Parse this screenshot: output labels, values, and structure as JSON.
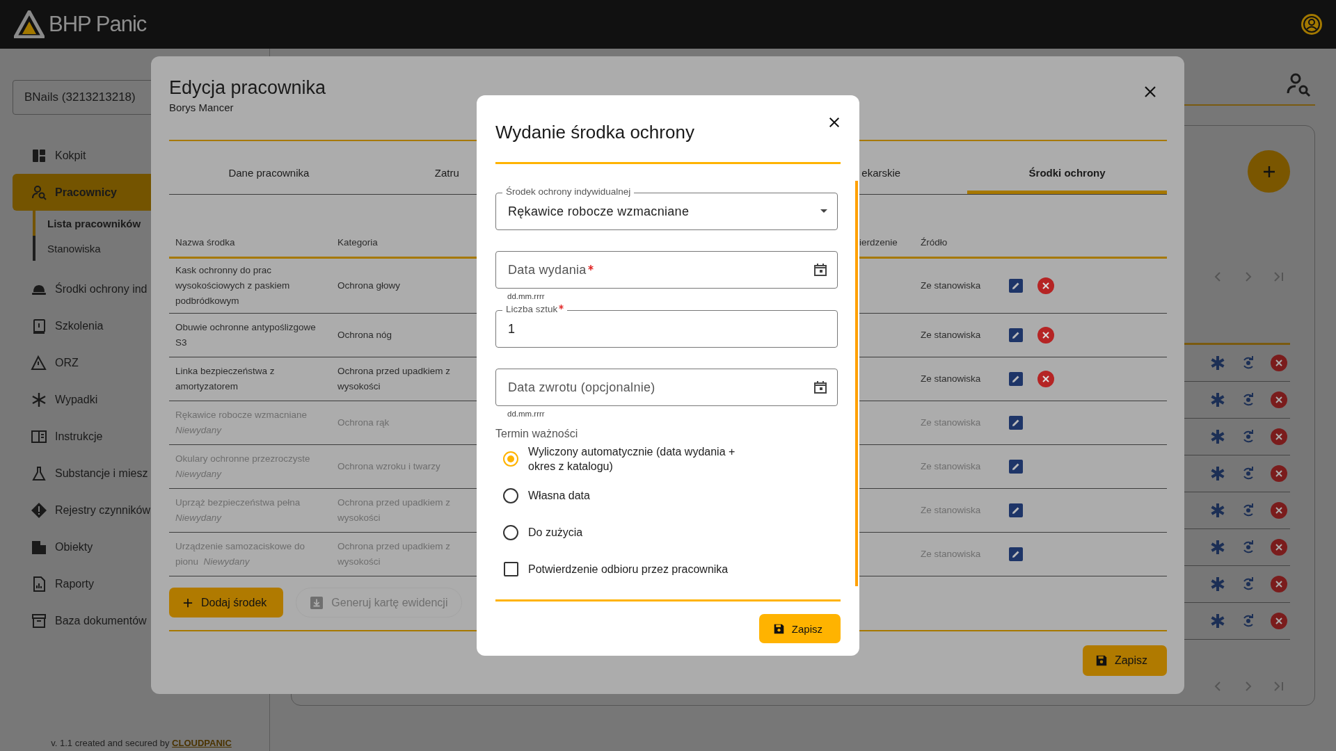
{
  "header": {
    "logo": "BHP Panic"
  },
  "sidebar": {
    "company": "BNails (3213213218)",
    "items": [
      {
        "label": "Kokpit",
        "selected": false
      },
      {
        "label": "Pracownicy",
        "selected": true,
        "children": [
          {
            "label": "Lista pracowników",
            "selected": true
          },
          {
            "label": "Stanowiska",
            "selected": false
          }
        ]
      },
      {
        "label": "Środki ochrony ind",
        "selected": false
      },
      {
        "label": "Szkolenia",
        "selected": false
      },
      {
        "label": "ORZ",
        "selected": false
      },
      {
        "label": "Wypadki",
        "selected": false
      },
      {
        "label": "Instrukcje",
        "selected": false
      },
      {
        "label": "Substancje i miesz",
        "selected": false
      },
      {
        "label": "Rejestry czynników",
        "selected": false
      },
      {
        "label": "Obiekty",
        "selected": false
      },
      {
        "label": "Raporty",
        "selected": false
      },
      {
        "label": "Baza dokumentów",
        "selected": false
      }
    ],
    "footer": {
      "text": "v. 1.1 created and secured by",
      "link": "CLOUDPANIC"
    }
  },
  "employee_dialog": {
    "title": "Edycja pracownika",
    "subtitle": "Borys Mancer",
    "tabs": [
      {
        "label": "Dane pracownika",
        "selected": false
      },
      {
        "label": "Zatru",
        "selected": false
      },
      {
        "label": "ekarskie",
        "selected": false
      },
      {
        "label": "Środki ochrony",
        "selected": true
      }
    ],
    "table": {
      "columns": [
        "Nazwa środka",
        "Kategoria",
        "ierdzenie",
        "Źródło"
      ],
      "rows": [
        {
          "name": "Kask ochronny do prac wysokościowych z paskiem podbródkowym",
          "category": "Ochrona głowy",
          "source": "Ze stanowiska",
          "issued": true
        },
        {
          "name": "Obuwie ochronne antypoślizgowe S3",
          "category": "Ochrona nóg",
          "source": "Ze stanowiska",
          "issued": true
        },
        {
          "name": "Linka bezpieczeństwa z amortyzatorem",
          "category": "Ochrona przed upadkiem z wysokości",
          "source": "Ze stanowiska",
          "issued": true
        },
        {
          "name": "Rękawice robocze wzmacniane",
          "status": "Niewydany",
          "category": "Ochrona rąk",
          "source": "Ze stanowiska",
          "issued": false
        },
        {
          "name": "Okulary ochronne przezroczyste",
          "status": "Niewydany",
          "category": "Ochrona wzroku i twarzy",
          "source": "Ze stanowiska",
          "issued": false
        },
        {
          "name": "Uprząż bezpieczeństwa pełna",
          "status": "Niewydany",
          "category": "Ochrona przed upadkiem z wysokości",
          "source": "Ze stanowiska",
          "issued": false
        },
        {
          "name": "Urządzenie samozaciskowe do pionu",
          "status": "Niewydany",
          "category": "Ochrona przed upadkiem z wysokości",
          "source": "Ze stanowiska",
          "issued": false
        }
      ]
    },
    "add_button": "Dodaj środek",
    "generate_button": {
      "label": "Generuj kartę ewidencji",
      "disabled": true
    },
    "save_button": "Zapisz"
  },
  "issue_dialog": {
    "title": "Wydanie środka ochrony",
    "ppe_select": {
      "label": "Środek ochrony indywidualnej",
      "value": "Rękawice robocze wzmacniane"
    },
    "issue_date": {
      "placeholder": "Data wydania",
      "required": true,
      "hint": "dd.mm.rrrr"
    },
    "quantity": {
      "label": "Liczba sztuk",
      "required": true,
      "value": "1"
    },
    "return_date": {
      "placeholder": "Data zwrotu (opcjonalnie)",
      "required": false,
      "hint": "dd.mm.rrrr"
    },
    "validity_label": "Termin ważności",
    "validity_options": [
      {
        "label": "Wyliczony automatycznie (data wydania + okres z katalogu)",
        "selected": true
      },
      {
        "label": "Własna data",
        "selected": false
      },
      {
        "label": "Do zużycia",
        "selected": false
      }
    ],
    "confirmation": {
      "label": "Potwierdzenie odbioru przez pracownika",
      "checked": false
    },
    "save_button": "Zapisz"
  }
}
